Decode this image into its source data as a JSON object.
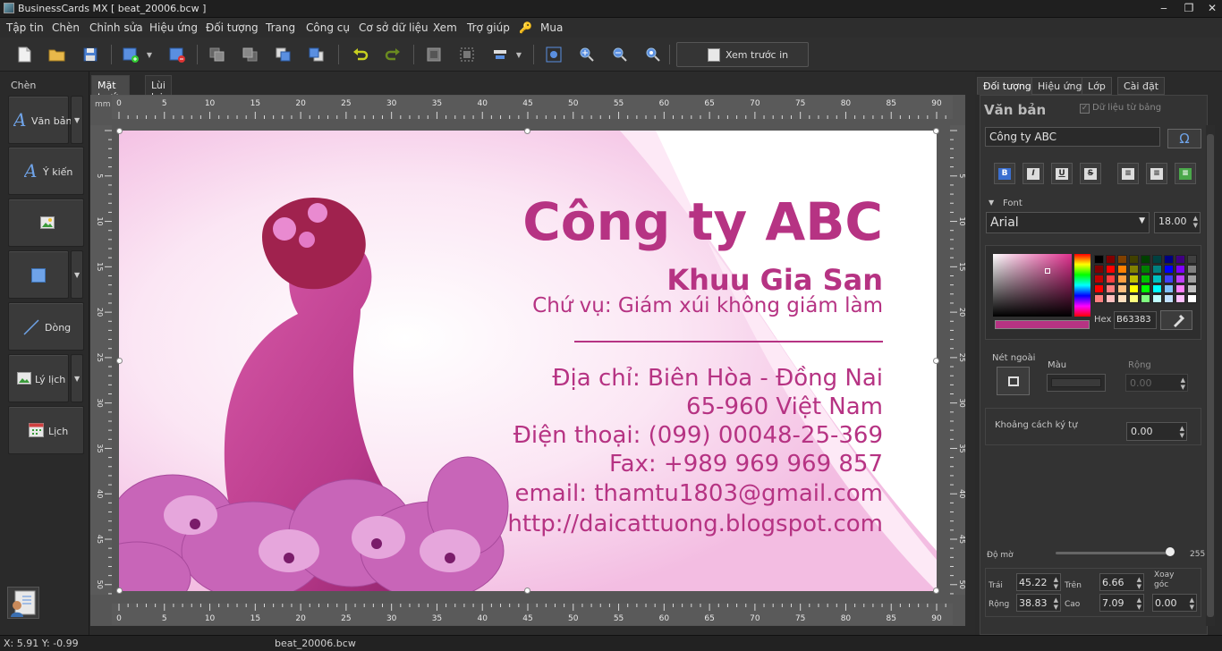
{
  "window": {
    "title": "BusinessCards MX [ beat_20006.bcw ]",
    "min": "‒",
    "restore": "❐",
    "close": "✕"
  },
  "menu": [
    "Tập tin",
    "Chèn",
    "Chỉnh sửa",
    "Hiệu ứng",
    "Đối tượng",
    "Trang",
    "Công cụ",
    "Cơ sở dữ liệu",
    "Xem",
    "Trợ giúp",
    "Mua"
  ],
  "toolbar": {
    "preview_label": "Xem trước in"
  },
  "leftpanel": {
    "title": "Chèn",
    "items": [
      {
        "label": "Văn bản",
        "icon": "text-icon"
      },
      {
        "label": "Ý kiến",
        "icon": "idea-icon"
      },
      {
        "label": "",
        "icon": "image-icon"
      },
      {
        "label": "",
        "icon": "shape-icon"
      },
      {
        "label": "Dòng",
        "icon": "line-icon"
      },
      {
        "label": "Lý lịch",
        "icon": "background-icon"
      },
      {
        "label": "Lịch",
        "icon": "calendar-icon"
      }
    ]
  },
  "doctabs": [
    "Mặt trước",
    "Lùi lại"
  ],
  "ruler": {
    "unit": "mm",
    "ticks": [
      "0",
      "5",
      "10",
      "15",
      "20",
      "25",
      "30",
      "35",
      "40",
      "45",
      "50",
      "55",
      "60",
      "65",
      "70",
      "75",
      "80",
      "85",
      "90"
    ],
    "vticks": [
      "5",
      "10",
      "15",
      "20",
      "25",
      "30",
      "35",
      "40",
      "45",
      "50"
    ]
  },
  "card": {
    "company": "Công ty ABC",
    "person": "Khuu Gia San",
    "position": "Chứ vụ: Giám xúi không giám làm",
    "address1": "Địa chỉ: Biên Hòa - Đồng Nai",
    "address2": "65-960 Việt Nam",
    "phone": "Điện thoại: (099) 00048-25-369",
    "fax": "Fax: +989 969 969 857",
    "email": "email: thamtu1803@gmail.com",
    "web": "http://daicattuong.blogspot.com",
    "text_color": "#b63383"
  },
  "rightpanel": {
    "tabs": [
      "Đối tượng",
      "Hiệu ứng",
      "Lớp",
      "Cài đặt"
    ],
    "section_title": "Văn bản",
    "data_from_table": "Dữ liệu từ bảng",
    "text_value": "Công ty ABC",
    "omega": "Ω",
    "font_label": "Font",
    "font_name": "Arial",
    "font_size": "18.00",
    "hex_label": "Hex",
    "hex_value": "B63383",
    "outline_label": "Nét ngoài",
    "color_label": "Màu",
    "width_label": "Rộng",
    "width_value": "0.00",
    "spacing_label": "Khoảng cách ký tự",
    "spacing_value": "0.00",
    "opacity_label": "Độ mờ",
    "opacity_value": "255",
    "left_label": "Trái",
    "left_value": "45.22",
    "top_label": "Trên",
    "top_value": "6.66",
    "rotate_label": "Xoay góc",
    "rotate_value": "0.00",
    "width2_label": "Rộng",
    "width2_value": "38.83",
    "height_label": "Cao",
    "height_value": "7.09"
  },
  "status": {
    "coords": "X: 5.91 Y: -0.99",
    "file": "beat_20006.bcw"
  }
}
